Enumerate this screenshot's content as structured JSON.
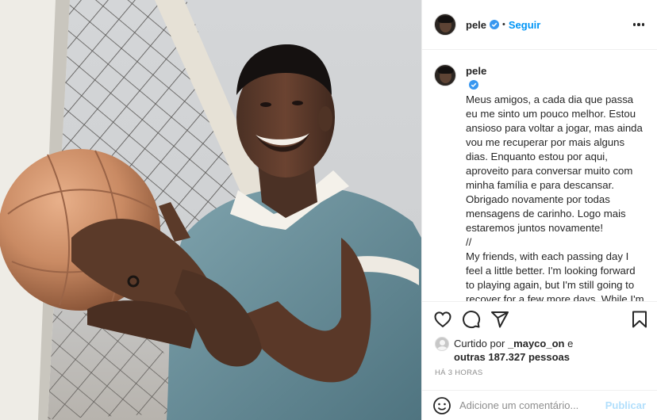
{
  "post": {
    "username": "pele",
    "follow_label": "Seguir",
    "separator": "•",
    "caption_pt": "Meus amigos, a cada dia que passa eu me sinto um pouco melhor. Estou ansioso para voltar a jogar, mas ainda vou me recuperar por mais alguns dias. Enquanto estou por aqui, aproveito para conversar muito com minha família e para descansar. Obrigado novamente por todas mensagens de carinho. Logo mais estaremos juntos novamente!",
    "caption_divider": "//",
    "caption_en": "My friends, with each passing day I feel a little better. I'm looking forward to playing again, but I'm still going to recover for a few more days. While I'm here, I take the opportunity to talk a lot with my family and to rest. Thank you again for all the messages of affection.",
    "likes_prefix": "Curtido por",
    "likes_user": "_mayco_on",
    "likes_and": "e",
    "likes_others": "outras 187.327 pessoas",
    "timestamp": "HÁ 3 HORAS",
    "comment_placeholder": "Adicione um comentário...",
    "publish_label": "Publicar"
  },
  "icons": {
    "verified": "verified-badge-icon",
    "more": "more-options-icon",
    "like": "heart-icon",
    "comment": "comment-icon",
    "share": "share-icon",
    "save": "bookmark-icon",
    "emoji": "emoji-icon"
  },
  "colors": {
    "accent": "#0095f6",
    "verified": "#3897f0",
    "publish_disabled": "#b2dffc",
    "muted": "#8e8e8e"
  }
}
